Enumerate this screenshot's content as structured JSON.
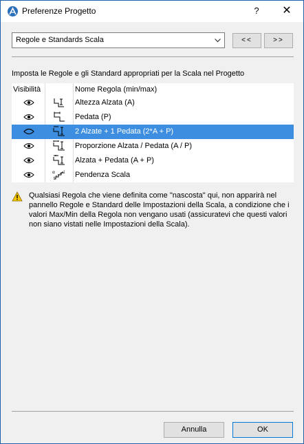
{
  "window": {
    "title": "Preferenze Progetto",
    "help_label": "?",
    "close_label": "✕"
  },
  "toolbar": {
    "dropdown_value": "Regole e Standards Scala",
    "prev_label": "<<",
    "next_label": ">>"
  },
  "instruction": "Imposta le Regole e gli Standard appropriati per la Scala nel Progetto",
  "table": {
    "header_visibility": "Visibilità",
    "header_name": "Nome Regola (min/max)",
    "rows": [
      {
        "label": "Altezza Alzata (A)",
        "icon": "riser-height-icon"
      },
      {
        "label": "Pedata (P)",
        "icon": "tread-depth-icon"
      },
      {
        "label": "2 Alzate + 1 Pedata (2*A + P)",
        "icon": "two-risers-one-tread-icon"
      },
      {
        "label": "Proporzione Alzata / Pedata (A / P)",
        "icon": "riser-tread-ratio-icon"
      },
      {
        "label": "Alzata + Pedata (A + P)",
        "icon": "riser-plus-tread-icon"
      },
      {
        "label": "Pendenza Scala",
        "icon": "stair-slope-icon"
      }
    ],
    "selected_index": 2
  },
  "warning": "Qualsiasi Regola che viene definita come \"nascosta\" qui, non apparirà nel pannello Regole e Standard delle Impostazioni della Scala, a condizione che i valori Max/Min della Regola non vengano usati (assicuratevi che questi valori non siano vistati nelle Impostazioni della Scala).",
  "buttons": {
    "cancel": "Annulla",
    "ok": "OK"
  },
  "colors": {
    "selection": "#3d8ee0",
    "accent": "#0078d7"
  }
}
